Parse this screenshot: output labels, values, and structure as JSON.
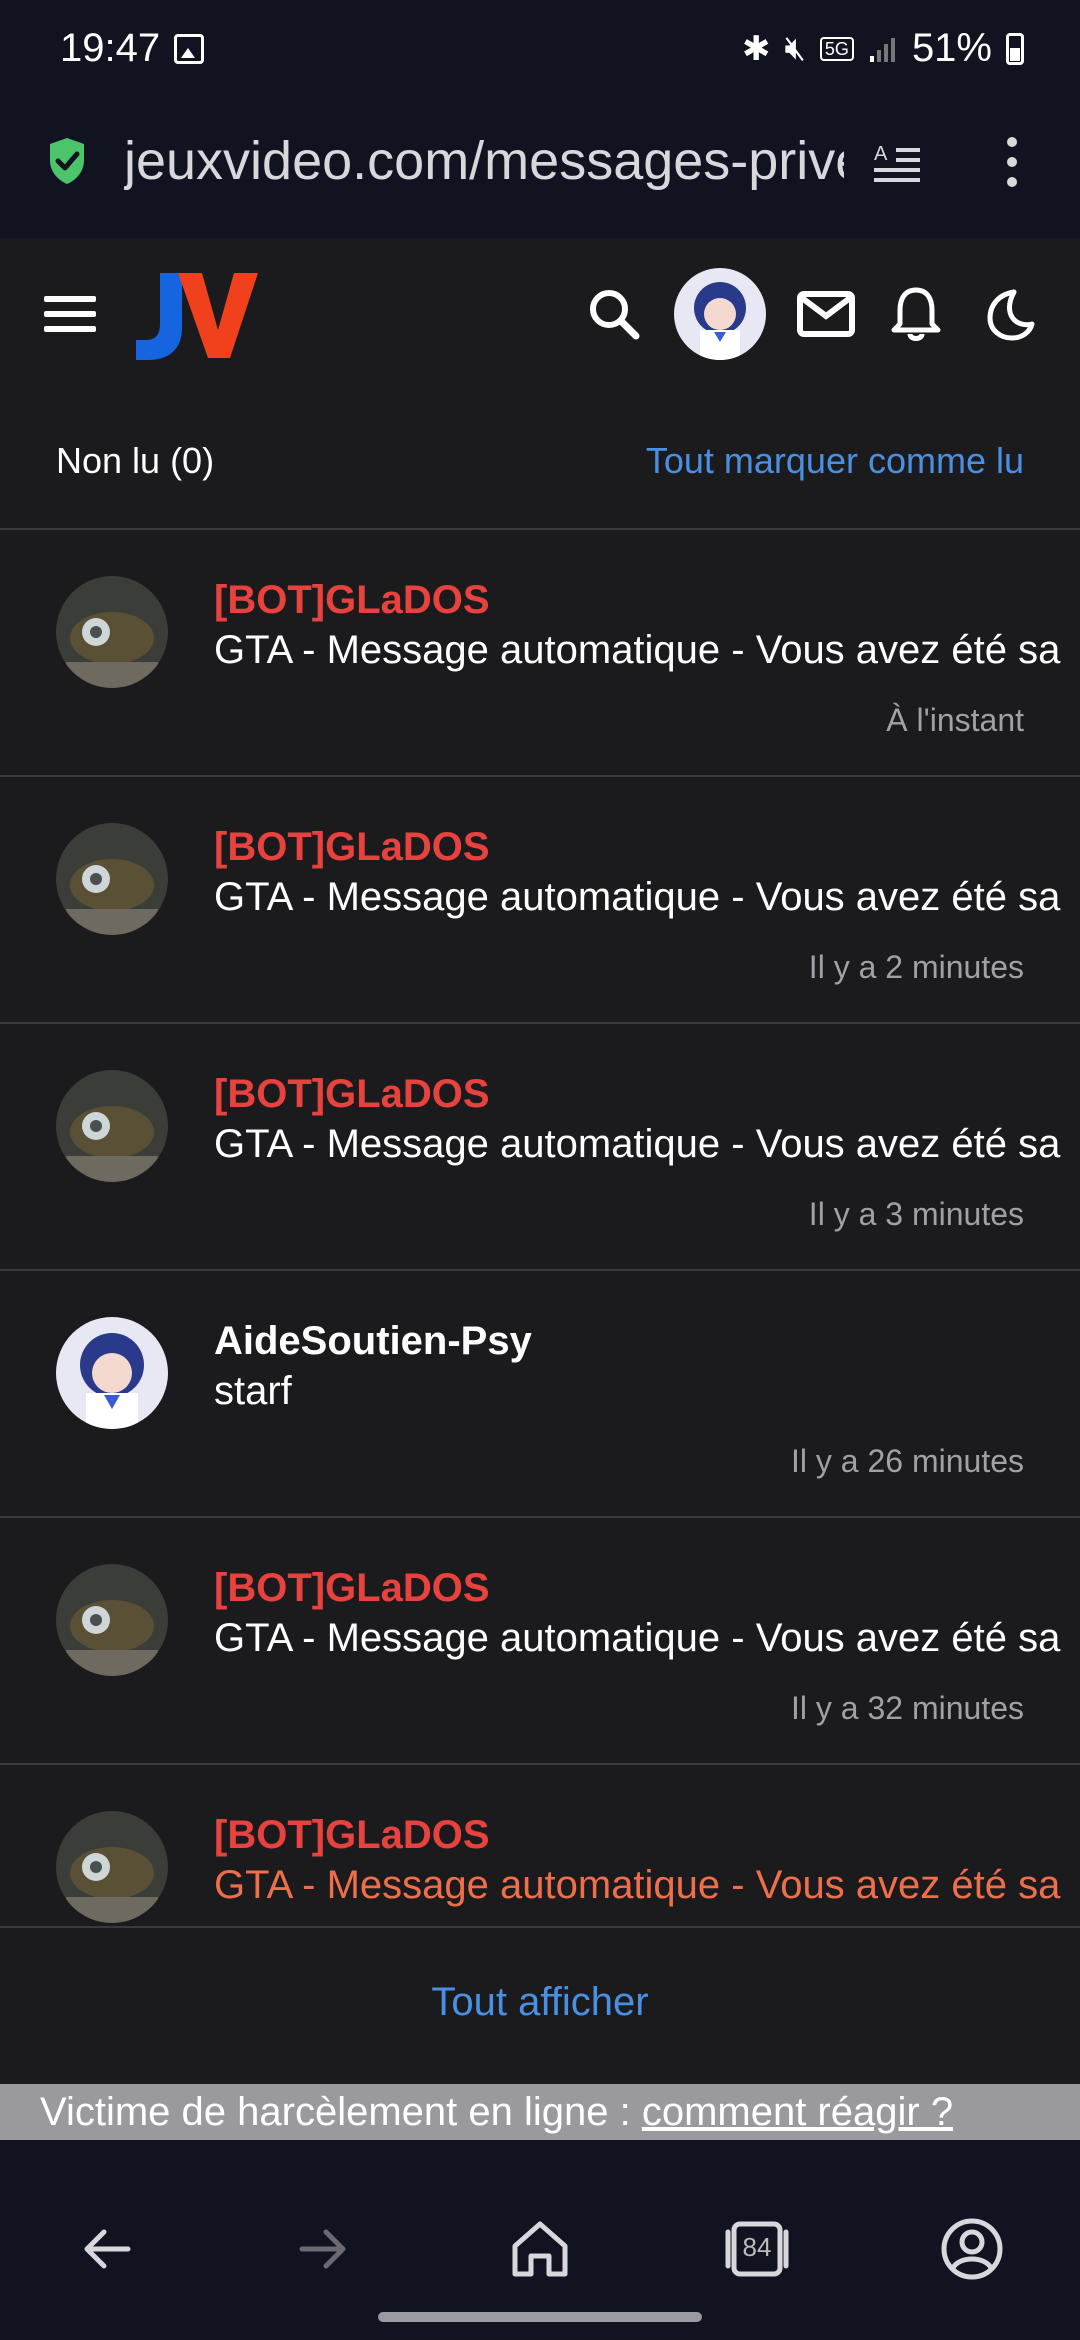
{
  "status_bar": {
    "time": "19:47",
    "network": "5G",
    "battery": "51%"
  },
  "browser": {
    "url": "jeuxvideo.com/messages-privés",
    "tabs_count": "84"
  },
  "header": {
    "logo_text": "JV"
  },
  "inbox": {
    "unread_label": "Non lu (0)",
    "mark_all_read": "Tout marquer comme lu",
    "show_all": "Tout afficher"
  },
  "messages": [
    {
      "author": "[BOT]GLaDOS",
      "subject": "GTA - Message automatique - Vous avez été sa",
      "time": "À l'instant"
    },
    {
      "author": "[BOT]GLaDOS",
      "subject": "GTA - Message automatique - Vous avez été sa",
      "time": "Il y a 2 minutes"
    },
    {
      "author": "[BOT]GLaDOS",
      "subject": "GTA - Message automatique - Vous avez été sa",
      "time": "Il y a 3 minutes"
    },
    {
      "author": "AideSoutien-Psy",
      "subject": "starf",
      "time": "Il y a 26 minutes"
    },
    {
      "author": "[BOT]GLaDOS",
      "subject": "GTA - Message automatique - Vous avez été sa",
      "time": "Il y a 32 minutes"
    },
    {
      "author": "[BOT]GLaDOS",
      "subject": "GTA - Message automatique - Vous avez été sa",
      "time": ""
    }
  ],
  "banner": {
    "text": "Victime de harcèlement en ligne : ",
    "link": "comment réagir ?"
  },
  "colors": {
    "accent_blue": "#4a90e2",
    "bot_red": "#e8423f",
    "background": "#1b1b1e"
  }
}
